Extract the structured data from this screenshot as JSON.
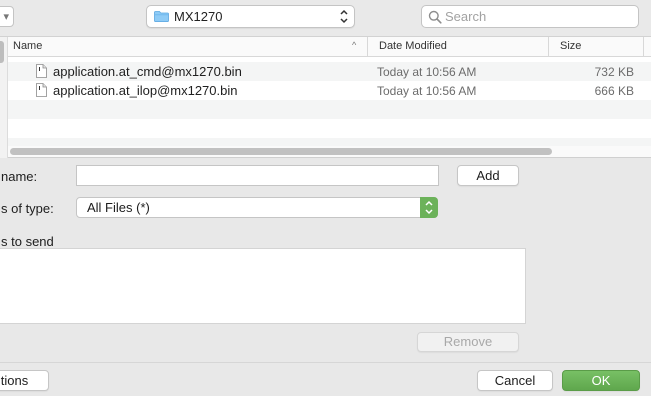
{
  "toolbar": {
    "path": "MX1270",
    "search_placeholder": "Search",
    "folder_icon": "folder-icon",
    "accent": "#7bbff2"
  },
  "browser": {
    "columns": [
      "Name",
      "Date Modified",
      "Size"
    ],
    "sort_indicator": "^",
    "files": [
      {
        "name": "application.at_cmd@mx1270.bin",
        "date": "Today at 10:56 AM",
        "size": "732 KB",
        "icon": "document-icon"
      },
      {
        "name": "application.at_ilop@mx1270.bin",
        "date": "Today at 10:56 AM",
        "size": "666 KB",
        "icon": "document-icon"
      }
    ]
  },
  "form": {
    "name_label": "name:",
    "name_value": "",
    "add_label": "Add",
    "type_label": "s of type:",
    "type_value": "All Files (*)",
    "send_label": "s to send",
    "remove_label": "Remove"
  },
  "footer": {
    "options_label": "tions",
    "cancel_label": "Cancel",
    "ok_label": "OK",
    "ok_color": "#6cb25a"
  }
}
